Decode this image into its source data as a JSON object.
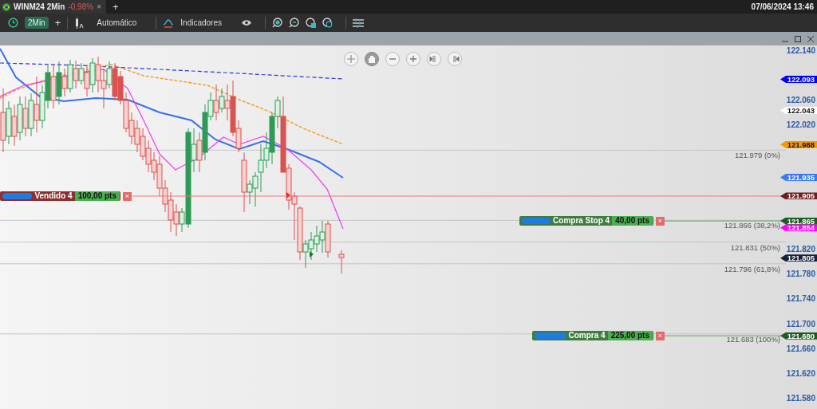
{
  "title_bar": {
    "tab": {
      "symbol": "WINM24 2Min",
      "change": "-0,98%",
      "close": "×"
    },
    "new_tab": "+",
    "datetime": "07/06/2024 13:46"
  },
  "toolbar": {
    "interval": "2Min",
    "add": "+",
    "chart_type": "Automático",
    "indicators": "Indicadores"
  },
  "chart": {
    "tools": [
      {
        "kind": "move",
        "selected": false
      },
      {
        "kind": "pan",
        "selected": true
      },
      {
        "kind": "zoom-out",
        "selected": false
      },
      {
        "kind": "zoom-in",
        "selected": false
      },
      {
        "kind": "left",
        "selected": false
      },
      {
        "kind": "right",
        "selected": false
      }
    ],
    "price_axis": [
      "122.140",
      "122.060",
      "122.020",
      "121.820",
      "121.780",
      "121.740",
      "121.700",
      "121.660",
      "121.620",
      "121.580"
    ],
    "price_tags": [
      {
        "price": "122.093",
        "color": "#0000ff"
      },
      {
        "price": "122.043",
        "color": "#ffffff"
      },
      {
        "price": "121.988",
        "color": "#f59a00"
      },
      {
        "price": "121.935",
        "color": "#3b78f5"
      },
      {
        "price": "121.854",
        "color": "#ff00ff"
      },
      {
        "price": "121.805",
        "color": "#14213a"
      }
    ],
    "fibonacci": [
      "121.979 (0%)",
      "121.866 (38,2%)",
      "121.831 (50%)",
      "121.796 (61,8%)",
      "121.683 (100%)"
    ],
    "orders": [
      {
        "kind": "sell",
        "label": "Vendido 4",
        "points": "100,00 pts",
        "close": "×",
        "price": "121.905",
        "color": "#6e1c1c"
      },
      {
        "kind": "buy",
        "label": "Compra Stop 4",
        "points": "40,00 pts",
        "close": "×",
        "price": "121.865",
        "color": "#1f5c24"
      },
      {
        "kind": "buy",
        "label": "Compra 4",
        "points": "225,00 pts",
        "close": "×",
        "price": "121.680",
        "color": "#1f5c24"
      }
    ]
  }
}
